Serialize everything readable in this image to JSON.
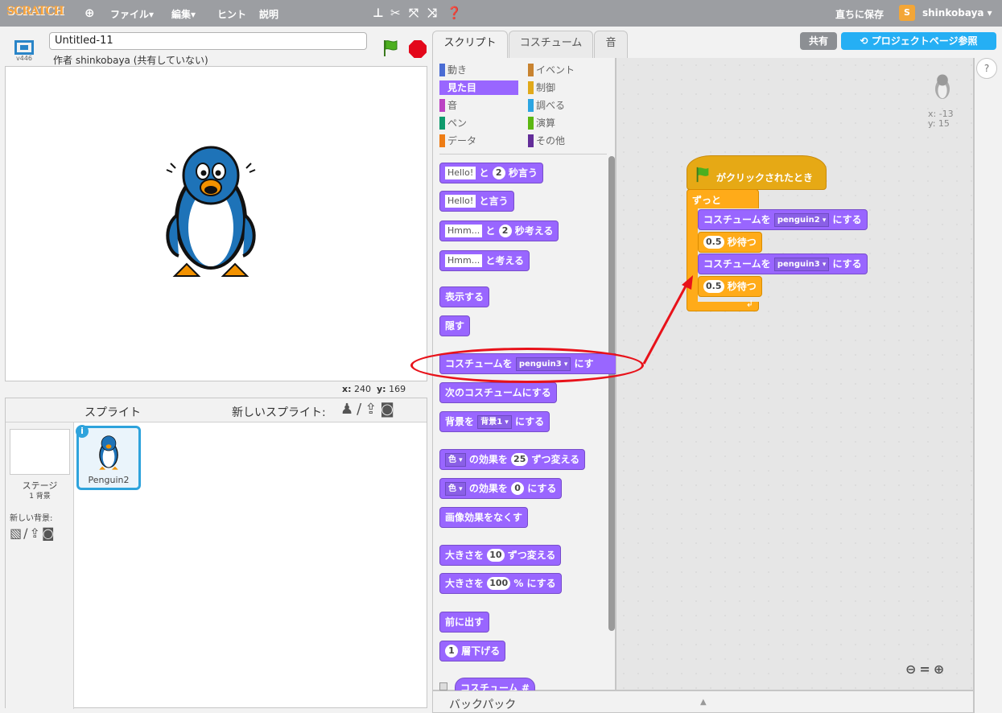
{
  "topbar": {
    "logo": "SCRATCH",
    "menus": [
      "ファイル▾",
      "編集▾",
      "ヒント",
      "説明"
    ],
    "save_now": "直ちに保存",
    "user_badge": "S",
    "username": "shinkobaya ▾"
  },
  "stage": {
    "version": "v446",
    "project_title": "Untitled-11",
    "author": "作者 shinkobaya (共有していない)",
    "coords_x_label": "x:",
    "coords_x": "240",
    "coords_y_label": "y:",
    "coords_y": "169"
  },
  "sprites": {
    "title": "スプライト",
    "new_sprite": "新しいスプライト:",
    "stage_label": "ステージ",
    "stage_sub": "1 背景",
    "new_backdrop": "新しい背景:",
    "sprite_name": "Penguin2",
    "info": "i"
  },
  "tabs": [
    "スクリプト",
    "コスチューム",
    "音"
  ],
  "share": "共有",
  "project_page": "プロジェクトページ参照",
  "categories": [
    {
      "label": "動き",
      "color": "#4a6cd4"
    },
    {
      "label": "イベント",
      "color": "#c88330"
    },
    {
      "label": "見た目",
      "color": "#8a55d7"
    },
    {
      "label": "制御",
      "color": "#e1a91a"
    },
    {
      "label": "音",
      "color": "#bb42c3"
    },
    {
      "label": "調べる",
      "color": "#2ca5e2"
    },
    {
      "label": "ペン",
      "color": "#0e9a6c"
    },
    {
      "label": "演算",
      "color": "#5cb712"
    },
    {
      "label": "データ",
      "color": "#ee7d16"
    },
    {
      "label": "その他",
      "color": "#632d99"
    }
  ],
  "palette": {
    "hello": "Hello!",
    "hmm": "Hmm...",
    "to": "と",
    "say_secs": "秒言う",
    "say": "と言う",
    "think_secs": "秒考える",
    "think": "と考える",
    "two": "2",
    "show": "表示する",
    "hide": "隠す",
    "switch_costume_a": "コスチュームを",
    "switch_costume_b": "にす",
    "costume_val": "penguin3",
    "next_costume": "次のコスチュームにする",
    "backdrop_a": "背景を",
    "backdrop_val": "背景1",
    "backdrop_b": "にする",
    "effect_dd": "色",
    "change_effect": "の効果を",
    "by": "ずつ変える",
    "effect_25": "25",
    "set_effect_val": "0",
    "set_suffix": "にする",
    "clear_effects": "画像効果をなくす",
    "size_change_a": "大きさを",
    "size_10": "10",
    "size_set_100": "100",
    "size_pct": "% にする",
    "front": "前に出す",
    "back_num": "1",
    "back_layer": "層下げる",
    "costume_num": "コスチューム #"
  },
  "script": {
    "hat": "がクリックされたとき",
    "forever": "ずっと",
    "costume_a": "コスチュームを",
    "costume_1": "penguin2",
    "costume_2": "penguin3",
    "suffix": "にする",
    "wait_val": "0.5",
    "wait": "秒待つ",
    "sprite_x": "x: -13",
    "sprite_y": "y: 15"
  },
  "backpack": "バックパック"
}
